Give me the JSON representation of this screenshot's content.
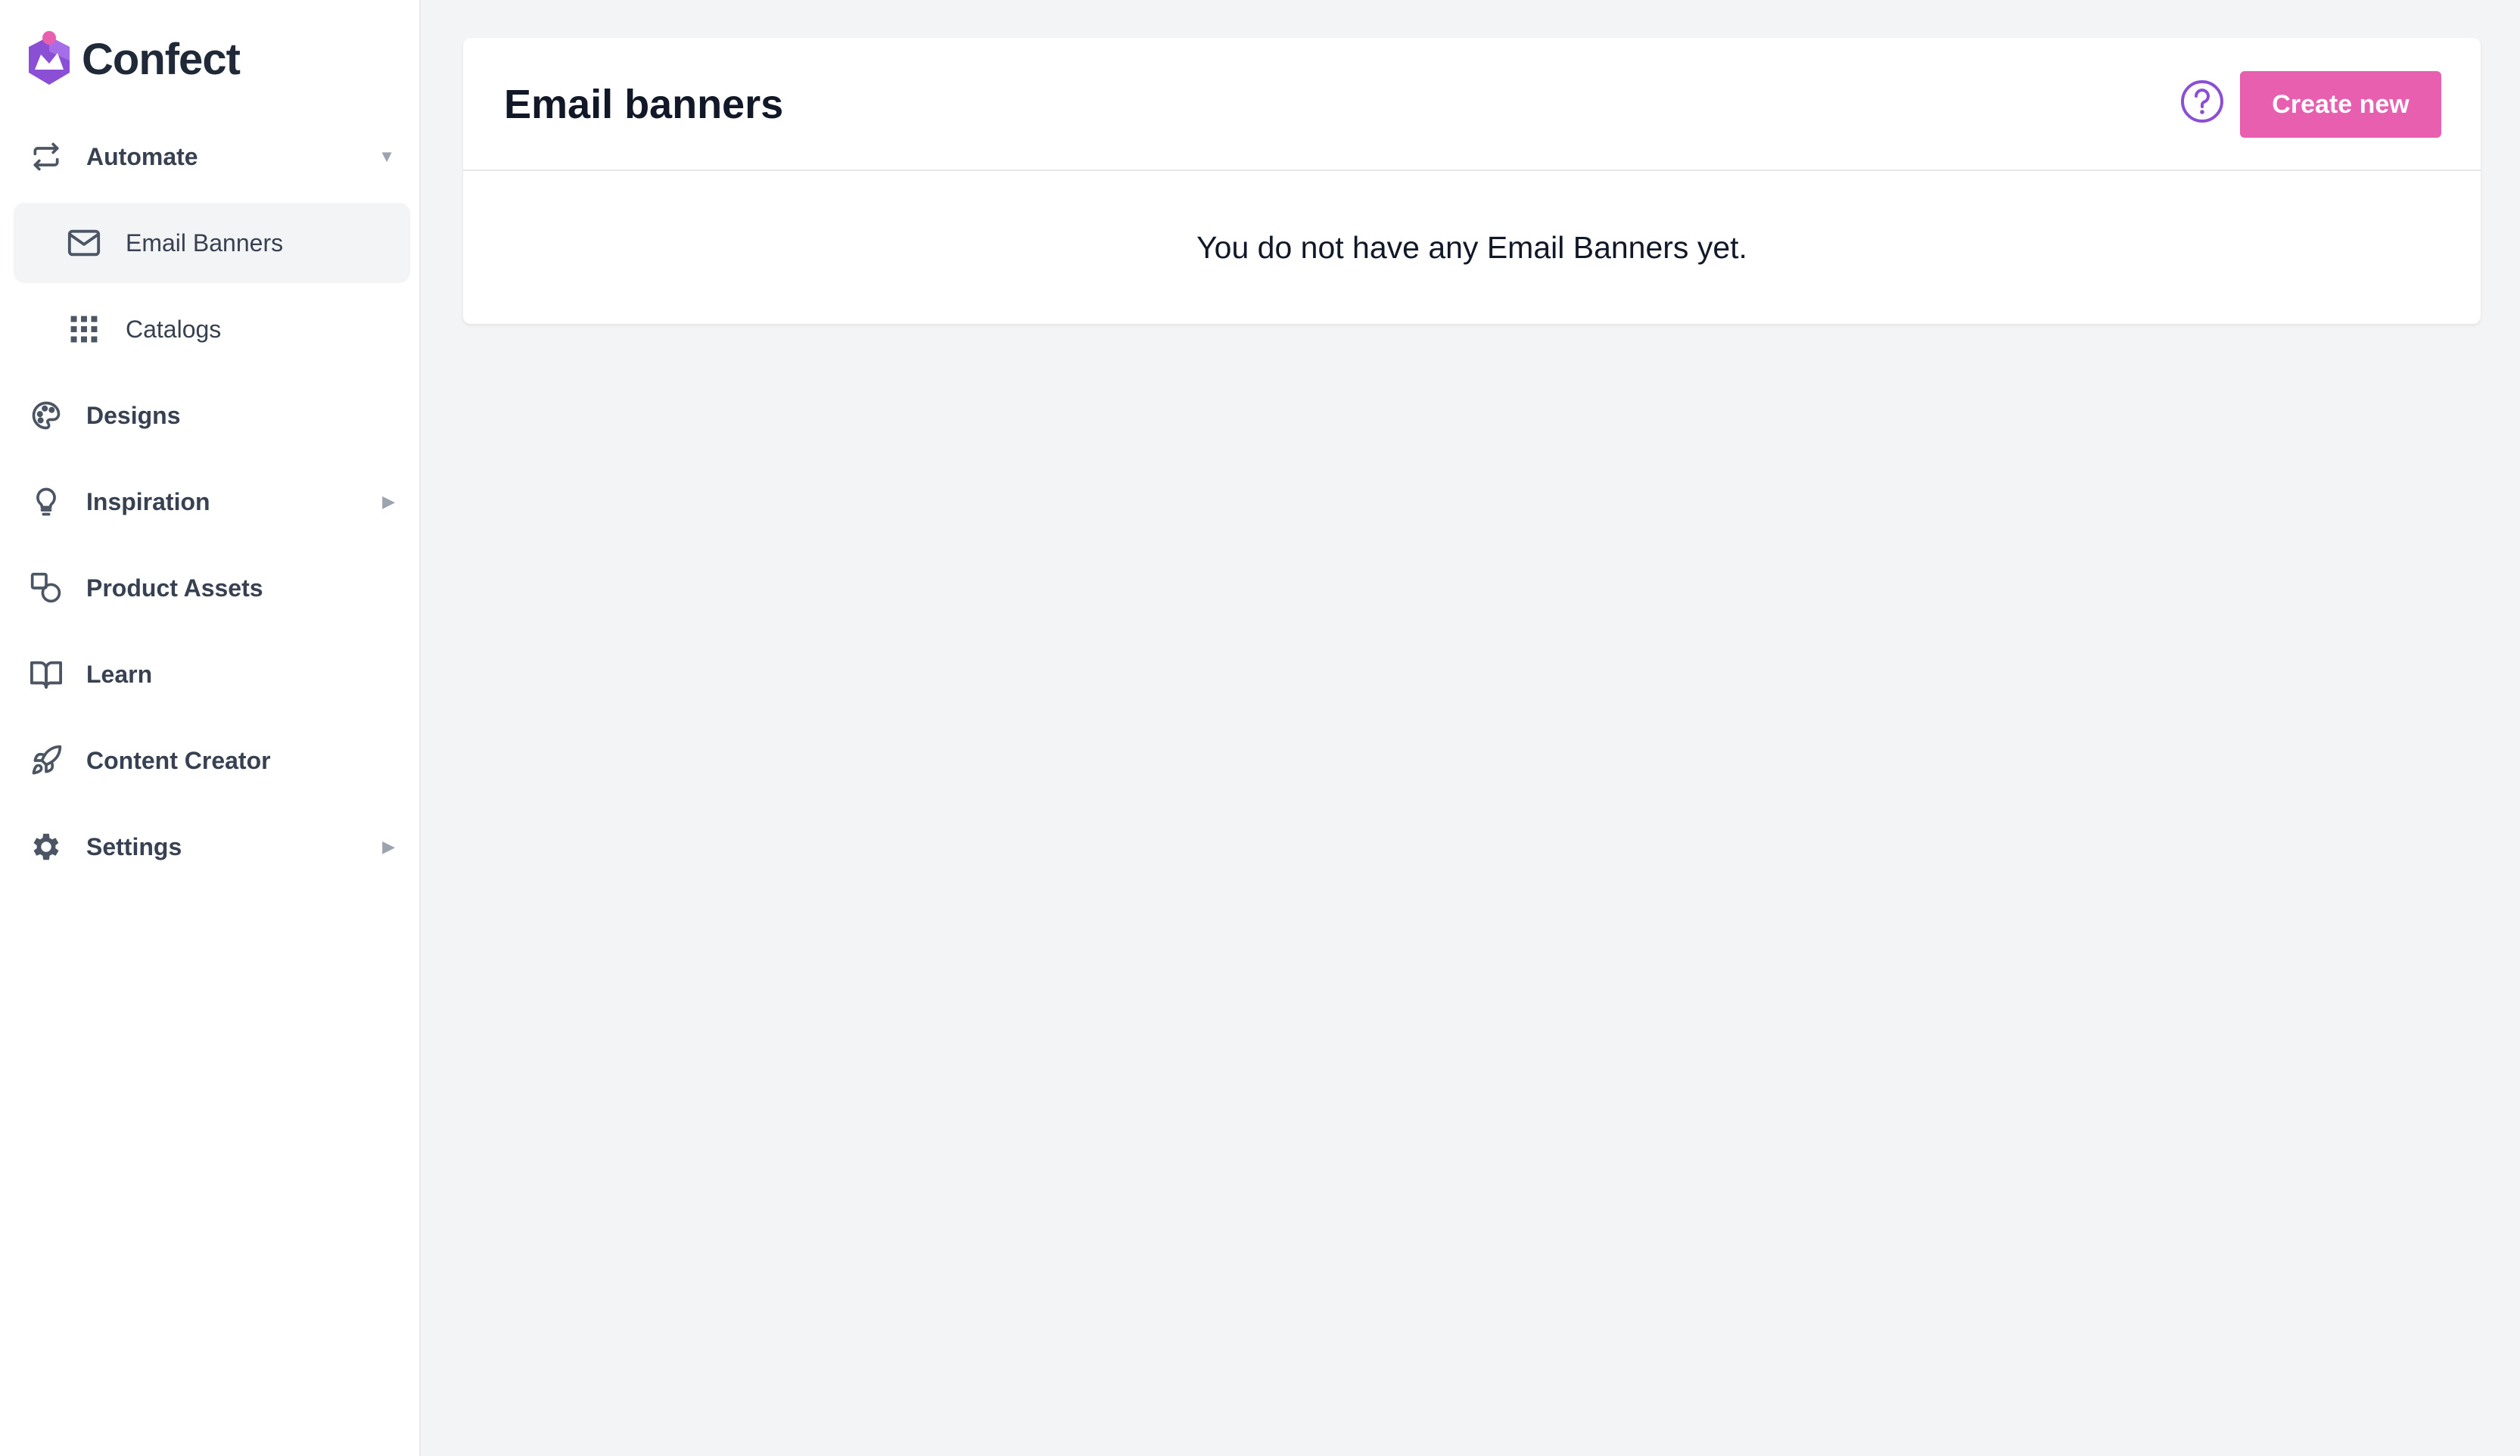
{
  "brand": {
    "name": "Confect",
    "logo_icon": "confect-logo-icon"
  },
  "sidebar": {
    "items": [
      {
        "label": "Automate",
        "icon": "repeat-arrows-icon",
        "arrow": "▼",
        "expanded": true
      },
      {
        "label": "Email Banners",
        "icon": "envelope-icon",
        "active": true
      },
      {
        "label": "Catalogs",
        "icon": "grid-dots-icon"
      },
      {
        "label": "Designs",
        "icon": "palette-icon"
      },
      {
        "label": "Inspiration",
        "icon": "lightbulb-icon",
        "arrow": "▶"
      },
      {
        "label": "Product Assets",
        "icon": "shapes-icon"
      },
      {
        "label": "Learn",
        "icon": "open-book-icon"
      },
      {
        "label": "Content Creator",
        "icon": "rocket-icon"
      },
      {
        "label": "Settings",
        "icon": "gear-icon",
        "arrow": "▶"
      }
    ]
  },
  "main": {
    "title": "Email banners",
    "help_icon": "question-circle-icon",
    "create_button_label": "Create new",
    "empty_message": "You do not have any Email Banners yet."
  },
  "colors": {
    "accent_pink": "#e85fb0",
    "accent_purple": "#8b4fd6",
    "background": "#f3f4f6",
    "sidebar_active": "#f3f4f6",
    "text_dark": "#111827",
    "icon_gray": "#4b5563"
  }
}
